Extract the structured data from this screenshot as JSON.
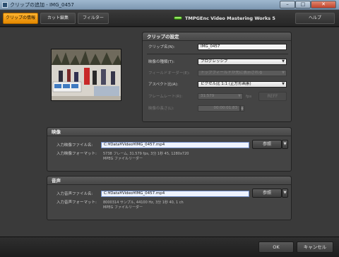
{
  "window": {
    "title": "クリップの追加 - IMG_0457",
    "minimize": "–",
    "maximize": "□",
    "close": "✕"
  },
  "toolbar": {
    "tabs": [
      {
        "label": "クリップの情報",
        "active": true
      },
      {
        "label": "カット編集",
        "active": false
      },
      {
        "label": "フィルター",
        "active": false
      }
    ],
    "brand": "TMPGEnc Video Mastering Works 5",
    "help_label": "ヘルプ"
  },
  "clip_settings": {
    "header": "クリップの設定",
    "clip_name_label": "クリップ名(N):",
    "clip_name_value": "IMG_0457",
    "video_type_label": "映像の種類(T):",
    "video_type_value": "プログレッシブ",
    "field_order_label": "フィールドオーダー(E):",
    "field_order_value": "トップフィールドが先に表示される",
    "aspect_label": "アスペクト比(A):",
    "aspect_value": "ピクセル比 1:1 (正方形画素)",
    "frame_rate_label": "フレームレート(R):",
    "frame_rate_value": "31.579",
    "frame_rate_unit": "fps",
    "frame_rate_button": "REFF",
    "duration_label": "映像の長さ(L):",
    "duration_value": "00:00:01.83"
  },
  "video": {
    "header": "映像",
    "file_label": "入力映像ファイル名:",
    "file_value": "C:¥Data¥Video¥IMG_0457.mp4",
    "format_label": "入力映像フォーマット:",
    "format_line1": "5738 フレーム, 31.579 fps, 3分 1秒 45, 1280x720",
    "format_line2": "MPEG ファイルリーダー",
    "browse_label": "参照"
  },
  "audio": {
    "header": "音声",
    "file_label": "入力音声ファイル名:",
    "file_value": "C:¥Data¥Video¥IMG_0457.mp4",
    "format_label": "入力音声フォーマット:",
    "format_line1": "8000314 サンプル, 44100 Hz, 3分 1秒 40, 1 ch",
    "format_line2": "MPEG ファイルリーダー",
    "browse_label": "参照"
  },
  "footer": {
    "ok_label": "OK",
    "cancel_label": "キャンセル"
  },
  "colors": {
    "accent_orange": "#f59a10",
    "panel_bg": "#444444",
    "window_bg": "#3a3a3a"
  }
}
